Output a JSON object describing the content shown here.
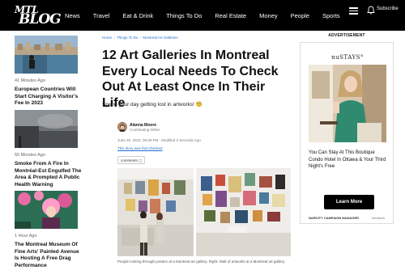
{
  "logo": {
    "line1": "MTL",
    "line2": "BLOG"
  },
  "nav": {
    "items": [
      "News",
      "Travel",
      "Eat & Drink",
      "Things To Do",
      "Real Estate",
      "Money",
      "People",
      "Sports"
    ],
    "subscribe_label": "Subscribe"
  },
  "sidebar": {
    "cards": [
      {
        "meta": "41 Minutes Ago",
        "title": "European Countries Will Start Charging A Visitor's Fee In 2023"
      },
      {
        "meta": "55 Minutes Ago",
        "title": "Smoke From A Fire In Montréal-Est Engulfed The Area & Prompted A Public Health Warning"
      },
      {
        "meta": "1 Hour Ago",
        "title": "The Montreal Museum Of Fine Arts' Painted Avenue Is Hosting A Free Drag Performance"
      }
    ]
  },
  "article": {
    "breadcrumb": [
      "Home",
      "Things To Do",
      "Montreal Art Galleries"
    ],
    "headline": "12 Art Galleries In Montreal Every Local Needs To Check Out At Least Once In Their Life",
    "subhead": "Spend your day getting lost in artworks! 🧐",
    "author": "Alanna Moore",
    "role": "Contributing Writer",
    "dates": "June 25, 2022, 05:39 PM · Modified 2 Seconds Ago",
    "factcheck": "This story was fact-checked",
    "comments_label": "comments",
    "caption": "People looking through posters at a Montreal art gallery. Right: Wall of artworks at a Montreal art gallery."
  },
  "ad": {
    "label": "ADVERTISEMENT",
    "brand": "nuSTAYS°",
    "copy": "You Can Stay At This Boutique Condo Hotel In Ottawa & Your Third Night's Free",
    "button": "Learn More",
    "footer_left": "NARCITY CAMPAIGN MANAGER",
    "footer_right": "feedback"
  }
}
